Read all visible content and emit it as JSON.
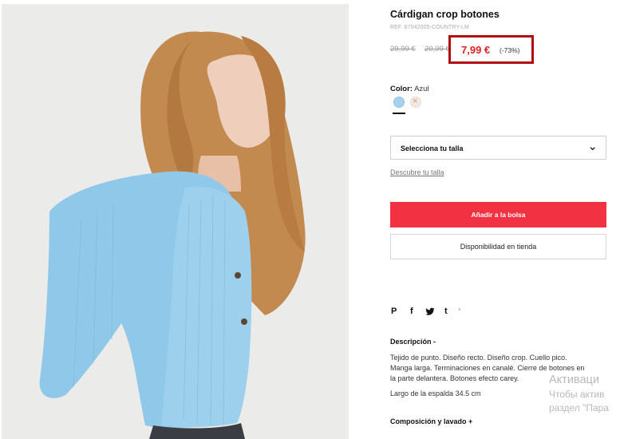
{
  "product": {
    "title": "Cárdigan crop botones",
    "ref": "REF. 87042005-COUNTRY-LM",
    "old_price_1": "29,99 €",
    "old_price_2": "20,99 €",
    "price": "7,99 €",
    "discount": "(-73%)"
  },
  "color": {
    "label": "Color:",
    "value": "Azul",
    "swatches": [
      "#a6d3ea",
      "#f3ebe3"
    ]
  },
  "size": {
    "select_label": "Selecciona tu talla",
    "guide_link": "Descubre tu talla"
  },
  "actions": {
    "add_to_bag": "Añadir a la bolsa",
    "store_availability": "Disponibilidad en tienda"
  },
  "share": {
    "pinterest": "P",
    "facebook": "f",
    "twitter": "t",
    "tumblr": "t",
    "more": "'"
  },
  "description": {
    "title": "Descripción  -",
    "lines": [
      "Tejido de punto. Diseño recto. Diseño crop. Cuello pico.",
      "Manga larga. Terminaciones en canalé. Cierre de botones en",
      "la parte delantera. Botones efecto carey."
    ],
    "back_length": "Largo de la espalda 34.5 cm"
  },
  "composition": {
    "title": "Composición y lavado  +"
  },
  "watermark": {
    "line1": "Активаци",
    "line2": "Чтобы актив",
    "line3": "раздел \"Пара"
  },
  "colors": {
    "accent_red": "#f23143",
    "price_red": "#e32020",
    "highlight_box": "#b00e12"
  }
}
